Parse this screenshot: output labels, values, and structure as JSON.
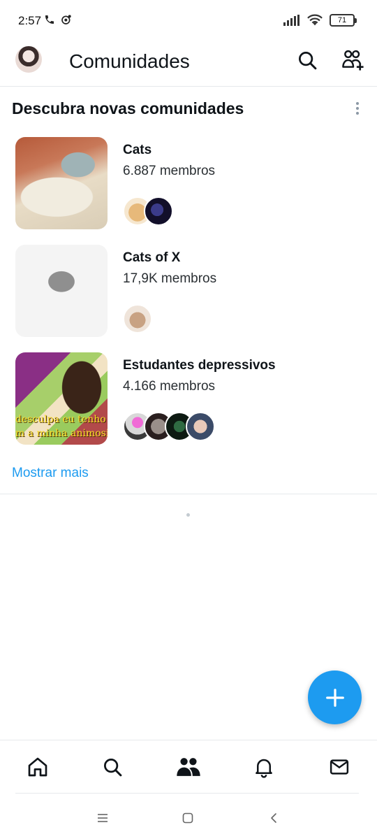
{
  "status_bar": {
    "time": "2:57",
    "battery": "71"
  },
  "header": {
    "title": "Comunidades"
  },
  "section": {
    "title": "Descubra novas comunidades"
  },
  "communities": [
    {
      "name": "Cats",
      "members": "6.887 membros"
    },
    {
      "name": "Cats of X",
      "members": "17,9K membros"
    },
    {
      "name": "Estudantes depressivos",
      "members": "4.166 membros",
      "thumbnail_caption": [
        "desculpa eu tenho p",
        "m a minha animosid"
      ]
    }
  ],
  "show_more": "Mostrar mais",
  "colors": {
    "accent": "#1d9bf0",
    "text_primary": "#0f1419",
    "divider": "#e6e9ec"
  },
  "icons": {
    "header": [
      "search-icon",
      "add-community-icon"
    ],
    "bottom_nav": [
      "home-icon",
      "search-icon",
      "communities-icon",
      "notifications-icon",
      "messages-icon"
    ],
    "system_nav": [
      "recents-icon",
      "home-square-icon",
      "back-icon"
    ],
    "fab": "plus-icon"
  }
}
